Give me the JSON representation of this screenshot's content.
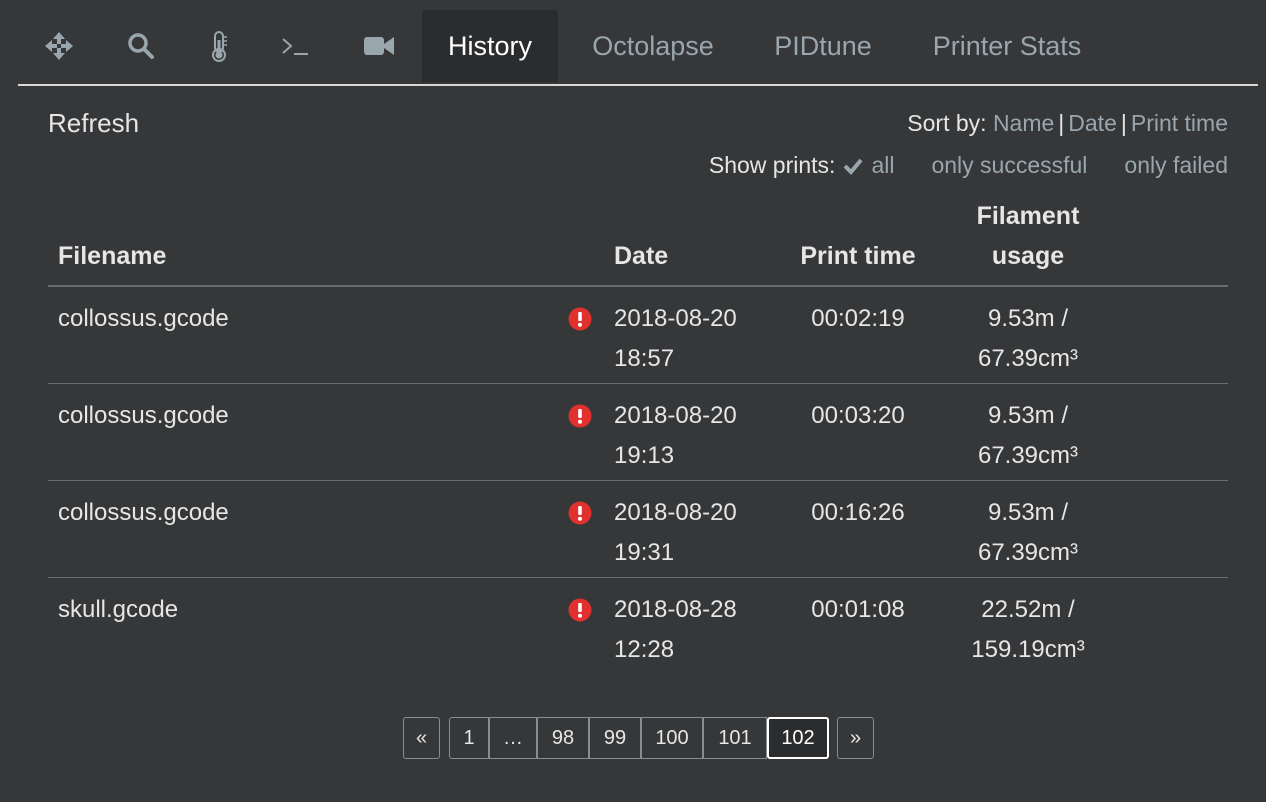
{
  "tabs": [
    {
      "id": "control",
      "icon": "move-arrows-icon",
      "label": ""
    },
    {
      "id": "gcode",
      "icon": "search-icon",
      "label": ""
    },
    {
      "id": "temperature",
      "icon": "thermometer-icon",
      "label": ""
    },
    {
      "id": "terminal",
      "icon": "terminal-icon",
      "label": "›_"
    },
    {
      "id": "timelapse",
      "icon": "video-camera-icon",
      "label": ""
    },
    {
      "id": "history",
      "label": "History",
      "active": true
    },
    {
      "id": "octolapse",
      "label": "Octolapse"
    },
    {
      "id": "pidtune",
      "label": "PIDtune"
    },
    {
      "id": "printer-stats",
      "label": "Printer Stats"
    }
  ],
  "toolbar": {
    "refresh_label": "Refresh",
    "sort_label": "Sort by:",
    "sort_options": [
      "Name",
      "Date",
      "Print time"
    ],
    "show_label": "Show prints:",
    "show_options": [
      "all",
      "only successful",
      "only failed"
    ],
    "show_selected": "all"
  },
  "table": {
    "headers": {
      "filename": "Filename",
      "date": "Date",
      "print_time": "Print time",
      "filament_line1": "Filament",
      "filament_line2": "usage"
    },
    "rows": [
      {
        "filename": "collossus.gcode",
        "status": "failed",
        "date": "2018-08-20",
        "time": "18:57",
        "print_time": "00:02:19",
        "filament_length": "9.53m /",
        "filament_volume": "67.39cm³"
      },
      {
        "filename": "collossus.gcode",
        "status": "failed",
        "date": "2018-08-20",
        "time": "19:13",
        "print_time": "00:03:20",
        "filament_length": "9.53m /",
        "filament_volume": "67.39cm³"
      },
      {
        "filename": "collossus.gcode",
        "status": "failed",
        "date": "2018-08-20",
        "time": "19:31",
        "print_time": "00:16:26",
        "filament_length": "9.53m /",
        "filament_volume": "67.39cm³"
      },
      {
        "filename": "skull.gcode",
        "status": "failed",
        "date": "2018-08-28",
        "time": "12:28",
        "print_time": "00:01:08",
        "filament_length": "22.52m /",
        "filament_volume": "159.19cm³"
      }
    ]
  },
  "pagination": {
    "prev": "«",
    "next": "»",
    "pages": [
      "1",
      "…",
      "98",
      "99",
      "100",
      "101",
      "102"
    ],
    "current": "102"
  },
  "colors": {
    "background": "#353739",
    "active_tab": "#2a2c2e",
    "link": "#9aa6ad",
    "error": "#e0312f"
  }
}
